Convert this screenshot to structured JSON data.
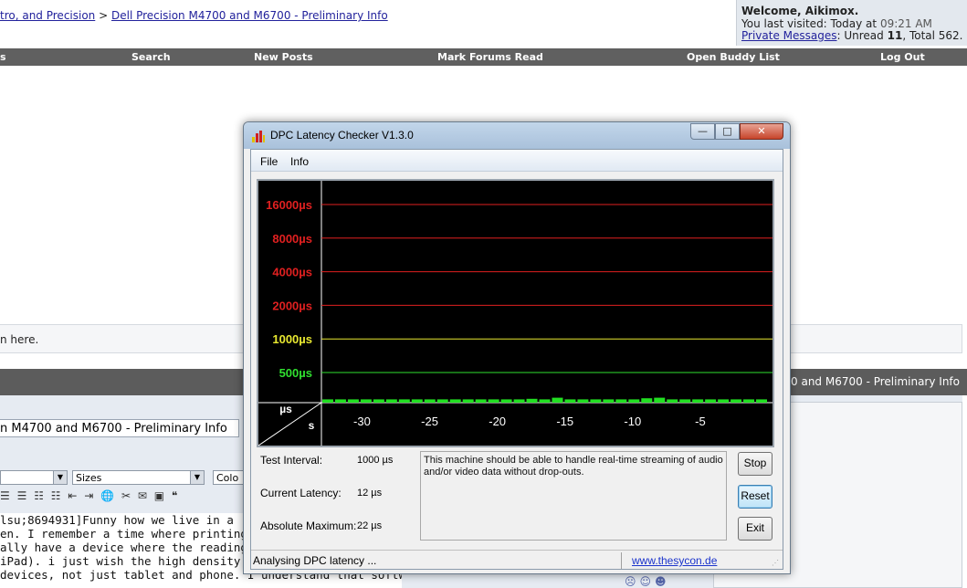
{
  "forum": {
    "breadcrumb": {
      "part1": "tro, and Precision",
      "sep": ">",
      "part2": "Dell Precision M4700 and M6700 - Preliminary Info"
    },
    "welcome": {
      "title": "Welcome, Aikimox.",
      "visited_prefix": "You last visited: Today at",
      "visited_time": "09:21 AM",
      "pm_link": "Private Messages",
      "pm_rest_prefix": ": Unread",
      "unread": "11",
      "pm_total": ", Total 562."
    },
    "nav": [
      "s",
      "Search",
      "New Posts",
      "Mark Forums Read",
      "Open Buddy List",
      "Log Out"
    ],
    "notice": "n here.",
    "darkbar_right": "0 and M6700 - Preliminary Info",
    "title_value": "n M4700 and M6700 - Preliminary Info",
    "size_select": "Sizes",
    "color_select": "Colo",
    "post_lines": [
      "lsu;8694931]Funny how we live in a 'high",
      "en. I remember a time where printing cou",
      "ally have a device where the reading exp",
      "iPad). i just wish the high density print c",
      " devices, not just tablet and phone. I understand that software"
    ]
  },
  "window": {
    "title": "DPC Latency Checker V1.3.0",
    "controls": {
      "minimize": "—",
      "maximize": "□",
      "close": "✕"
    },
    "menu": [
      "File",
      "Info"
    ],
    "test_interval_label": "Test Interval:",
    "test_interval_value": "1000 µs",
    "current_latency_label": "Current Latency:",
    "current_latency_value": "12 µs",
    "absolute_max_label": "Absolute Maximum:",
    "absolute_max_value": "22 µs",
    "info_text": "This machine should be able to handle real-time streaming of audio and/or video data without drop-outs.",
    "buttons": {
      "stop": "Stop",
      "reset": "Reset",
      "exit": "Exit"
    },
    "status": "Analysing DPC latency ...",
    "link": "www.thesycon.de"
  },
  "chart_data": {
    "type": "bar",
    "ylabel": "µs",
    "xlabel": "s",
    "y_levels": [
      {
        "label": "16000µs",
        "value": 16000,
        "color": "#e02020"
      },
      {
        "label": "8000µs",
        "value": 8000,
        "color": "#e02020"
      },
      {
        "label": "4000µs",
        "value": 4000,
        "color": "#e02020"
      },
      {
        "label": "2000µs",
        "value": 2000,
        "color": "#e02020"
      },
      {
        "label": "1000µs",
        "value": 1000,
        "color": "#e8e830"
      },
      {
        "label": "500µs",
        "value": 500,
        "color": "#30e030"
      }
    ],
    "x_ticks": [
      -30,
      -25,
      -20,
      -15,
      -10,
      -5
    ],
    "x_range": [
      -33,
      0
    ],
    "bar_color": "#22e022",
    "values": [
      12,
      12,
      12,
      12,
      12,
      12,
      12,
      12,
      12,
      12,
      12,
      12,
      12,
      12,
      12,
      12,
      14,
      12,
      18,
      12,
      12,
      12,
      12,
      12,
      12,
      16,
      18,
      12,
      12,
      12,
      12,
      12,
      12,
      12,
      12
    ]
  }
}
